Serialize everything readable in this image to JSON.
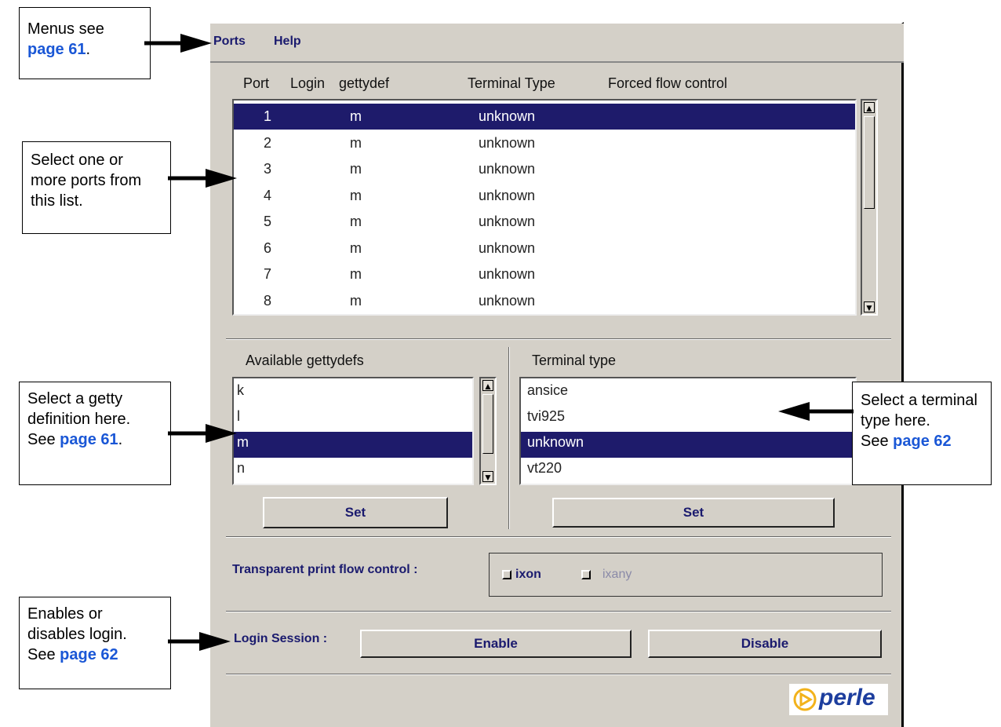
{
  "menubar": {
    "ports": "Ports",
    "help": "Help"
  },
  "ports_table": {
    "headers": [
      "Port",
      "Login",
      "gettydef",
      "Terminal Type",
      "Forced flow control"
    ],
    "rows": [
      {
        "port": "1",
        "login": "",
        "gettydef": "m",
        "terminal": "unknown",
        "flow": "",
        "selected": true
      },
      {
        "port": "2",
        "login": "",
        "gettydef": "m",
        "terminal": "unknown",
        "flow": ""
      },
      {
        "port": "3",
        "login": "",
        "gettydef": "m",
        "terminal": "unknown",
        "flow": ""
      },
      {
        "port": "4",
        "login": "",
        "gettydef": "m",
        "terminal": "unknown",
        "flow": ""
      },
      {
        "port": "5",
        "login": "",
        "gettydef": "m",
        "terminal": "unknown",
        "flow": ""
      },
      {
        "port": "6",
        "login": "",
        "gettydef": "m",
        "terminal": "unknown",
        "flow": ""
      },
      {
        "port": "7",
        "login": "",
        "gettydef": "m",
        "terminal": "unknown",
        "flow": ""
      },
      {
        "port": "8",
        "login": "",
        "gettydef": "m",
        "terminal": "unknown",
        "flow": ""
      }
    ]
  },
  "gettydefs": {
    "title": "Available gettydefs",
    "items": [
      "k",
      "l",
      "m",
      "n"
    ],
    "selected": "m",
    "set_label": "Set"
  },
  "terminal_types": {
    "title": "Terminal type",
    "items": [
      "ansice",
      "tvi925",
      "unknown",
      "vt220"
    ],
    "selected": "unknown",
    "set_label": "Set"
  },
  "flow_control": {
    "label": "Transparent print flow control :",
    "ixon": "ixon",
    "ixany": "ixany"
  },
  "login_session": {
    "label": "Login Session :",
    "enable": "Enable",
    "disable": "Disable"
  },
  "logo": {
    "text": "perle"
  },
  "callouts": {
    "menus": {
      "text": "Menus see",
      "link": "page 61",
      "suffix": "."
    },
    "ports": {
      "text": "Select one or more ports from this list."
    },
    "getty": {
      "text1": "Select a getty definition here.",
      "text2": "See",
      "link": "page 61",
      "suffix": "."
    },
    "terminal": {
      "text1": "Select a terminal type here.",
      "text2": "See",
      "link": "page 62"
    },
    "login": {
      "text1": "Enables or disables login.",
      "text2": "See",
      "link": "page 62"
    }
  },
  "colors": {
    "selection": "#1e1b6b",
    "window_bg": "#d4d0c8",
    "link": "#1a57d6",
    "label_text": "#1a1a6e"
  }
}
